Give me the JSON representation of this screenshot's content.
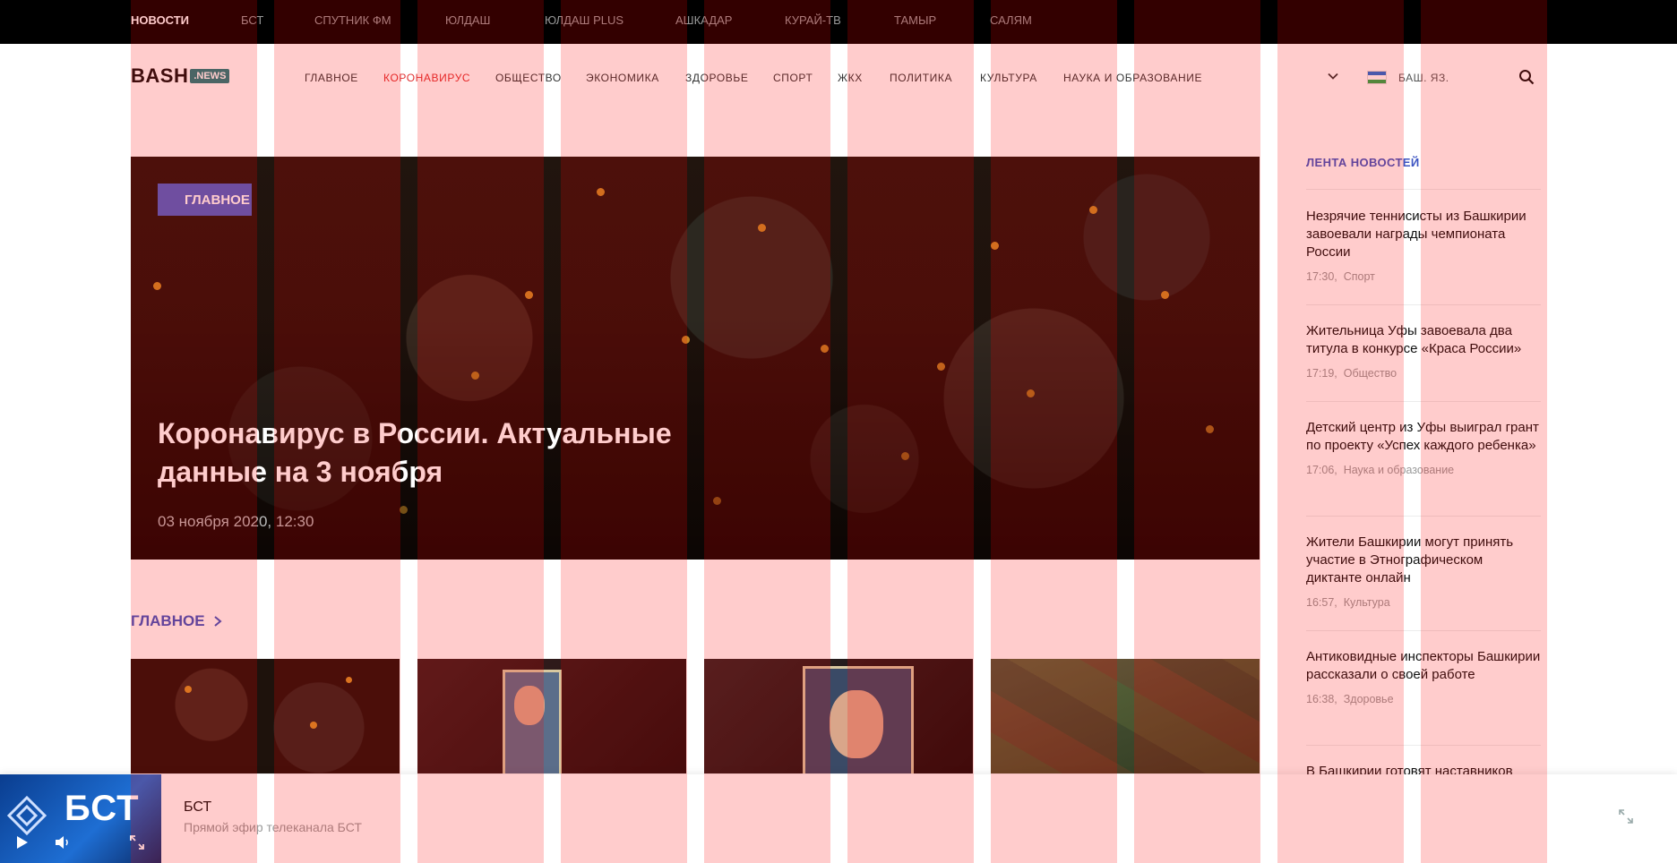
{
  "topbar": {
    "links": [
      "НОВОСТИ",
      "БСТ",
      "СПУТНИК ФМ",
      "ЮЛДАШ",
      "ЮЛДАШ PLUS",
      "АШКАДАР",
      "КУРАЙ-ТВ",
      "ТАМЫР",
      "САЛЯМ"
    ],
    "active": "НОВОСТИ"
  },
  "header": {
    "logo_text": "BASH",
    "logo_suffix": ".NEWS",
    "nav": [
      "ГЛАВНОЕ",
      "КОРОНАВИРУС",
      "ОБЩЕСТВО",
      "ЭКОНОМИКА",
      "ЗДОРОВЬЕ",
      "СПОРТ",
      "ЖКХ",
      "ПОЛИТИКА",
      "КУЛЬТУРА",
      "НАУКА И ОБРАЗОВАНИЕ"
    ],
    "highlighted_nav": "КОРОНАВИРУС",
    "language": "БАШ. ЯЗ.",
    "icons": [
      "chevron-down-icon",
      "bashkortostan-flag-icon",
      "search-icon"
    ]
  },
  "hero": {
    "tag": "ГЛАВНОЕ",
    "title": "Коронавирус в России. Актуальные данные на 3 ноября",
    "date": "03 ноября 2020, 12:30"
  },
  "section": {
    "title": "ГЛАВНОЕ"
  },
  "feed": {
    "title": "ЛЕНТА НОВОСТЕЙ",
    "items": [
      {
        "title": "Незрячие теннисисты из Башкирии завоевали награды чемпионата России",
        "time": "17:30,",
        "category": "Спорт"
      },
      {
        "title": "Жительница Уфы завоевала два титула в конкурсе «Краса России»",
        "time": "17:19,",
        "category": "Общество"
      },
      {
        "title": "Детский центр из Уфы выиграл грант по проекту «Успех каждого ребенка»",
        "time": "17:06,",
        "category": "Наука и образование"
      },
      {
        "title": "Жители Башкирии могут принять участие в Этнографическом диктанте онлайн",
        "time": "16:57,",
        "category": "Культура"
      },
      {
        "title": "Антиковидные инспекторы Башкирии рассказали о своей работе",
        "time": "16:38,",
        "category": "Здоровье"
      },
      {
        "title": "В Башкирии готовят наставников",
        "time": "",
        "category": ""
      }
    ]
  },
  "player": {
    "thumb_logo": "БСТ",
    "title": "БСТ",
    "subtitle": "Прямой эфир телеканала БСТ"
  },
  "colors": {
    "accent_blue": "#3d55c2",
    "tag_blue": "#4b62c9",
    "highlight_red": "#e03030",
    "overlay": "rgba(255,0,0,0.2)"
  }
}
